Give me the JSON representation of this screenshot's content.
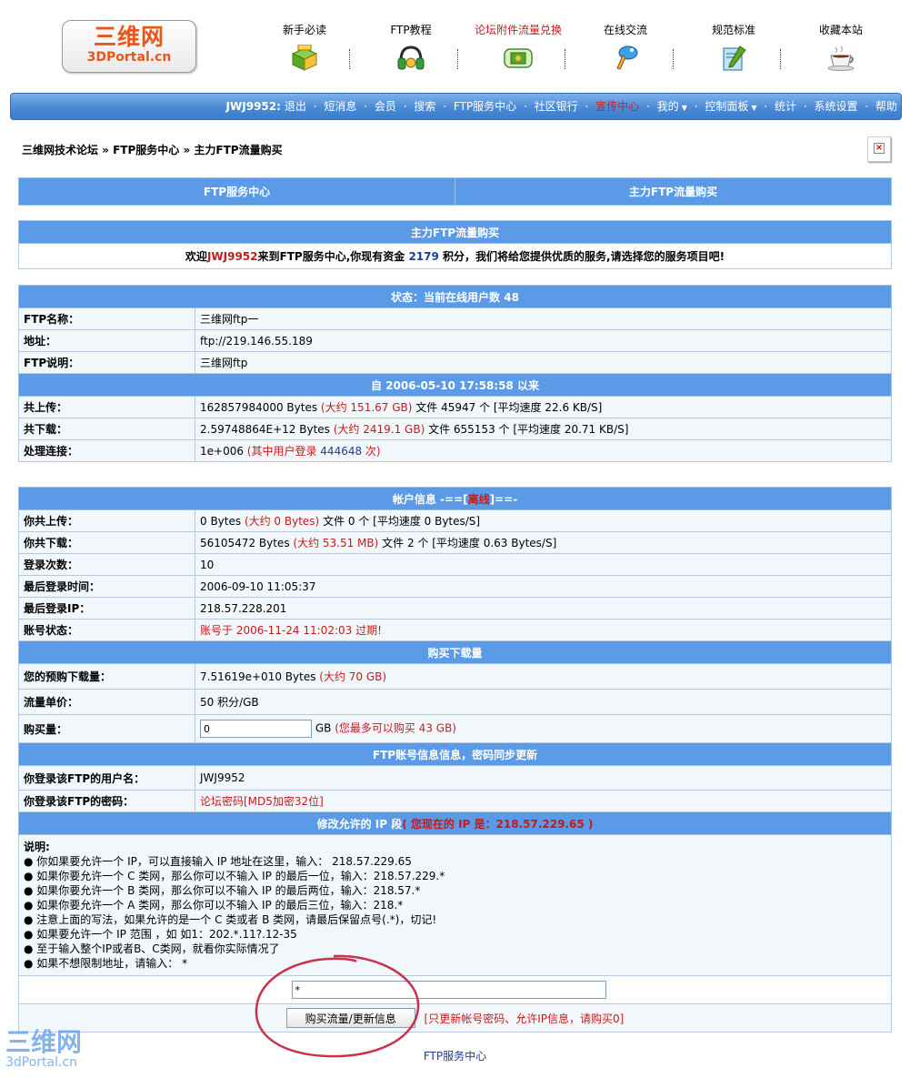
{
  "logo": {
    "cn": "三维网",
    "en": "3DPortal.cn"
  },
  "topnav": [
    {
      "label": "新手必读",
      "icon": "gift-box-icon",
      "color": "#000000"
    },
    {
      "label": "FTP教程",
      "icon": "headphones-icon",
      "color": "#000000"
    },
    {
      "label": "论坛附件流量兑换",
      "icon": "media-player-icon",
      "color": "#c41b1b"
    },
    {
      "label": "在线交流",
      "icon": "chat-pen-icon",
      "color": "#000000"
    },
    {
      "label": "规范标准",
      "icon": "document-edit-icon",
      "color": "#000000"
    },
    {
      "label": "收藏本站",
      "icon": "coffee-cup-icon",
      "color": "#000000"
    }
  ],
  "menubar": {
    "user": "JWJ9952:",
    "items": [
      "退出",
      "短消息",
      "会员",
      "搜索",
      "FTP服务中心",
      "社区银行",
      "宣传中心",
      "我的",
      "控制面板",
      "统计",
      "系统设置",
      "帮助"
    ]
  },
  "breadcrumb": "三维网技术论坛 » FTP服务中心 » 主力FTP流量购买",
  "tabs": [
    "FTP服务中心",
    "主力FTP流量购买"
  ],
  "welcome": {
    "title": "主力FTP流量购买",
    "pre": "欢迎",
    "user": "JWJ9952",
    "mid": "来到FTP服务中心,你现有资金 ",
    "points": "2179",
    "post": " 积分，我们将给您提供优质的服务,请选择您的服务项目吧!"
  },
  "status": {
    "title": "状态：当前在线用户数 48",
    "rows": [
      {
        "label": "FTP名称：",
        "value": "三维网ftp一"
      },
      {
        "label": "地址：",
        "value": "ftp://219.146.55.189"
      },
      {
        "label": "FTP说明：",
        "value": "三维网ftp"
      }
    ],
    "since": "自 2006-05-10 17:58:58 以来",
    "upload": {
      "label": "共上传：",
      "a": "162857984000 Bytes ",
      "b": "(大约 151.67 GB)",
      "c": " 文件 45947 个 [平均速度 22.6 KB/S]"
    },
    "download": {
      "label": "共下载：",
      "a": "2.59748864E+12 Bytes ",
      "b": "(大约 2419.1 GB)",
      "c": " 文件 655153 个 [平均速度 20.71 KB/S]"
    },
    "conn": {
      "label": "处理连接：",
      "a": "1e+006 ",
      "b": "(其中用户登录 ",
      "n": "444648",
      "c": " 次)"
    }
  },
  "account": {
    "title_pre": "帐户信息 -==[",
    "title_status": "离线",
    "title_post": "]==-",
    "upload": {
      "label": "你共上传：",
      "a": "0 Bytes ",
      "b": "(大约 0 Bytes)",
      "c": " 文件 0 个 [平均速度 0 Bytes/S]"
    },
    "download": {
      "label": "你共下载：",
      "a": "56105472 Bytes ",
      "b": "(大约 53.51 MB)",
      "c": " 文件 2 个 [平均速度 0.63 Bytes/S]"
    },
    "login_count": {
      "label": "登录次数：",
      "value": "10"
    },
    "last_login_time": {
      "label": "最后登录时间：",
      "value": "2006-09-10 11:05:37"
    },
    "last_login_ip": {
      "label": "最后登录IP：",
      "value": "218.57.228.201"
    },
    "acct_status": {
      "label": "账号状态：",
      "value": "账号于 2006-11-24 11:02:03 过期!"
    }
  },
  "buy": {
    "title": "购买下载量",
    "prebuy": {
      "label": "您的预购下载量：",
      "a": "7.51619e+010 Bytes ",
      "b": "(大约 70 GB)"
    },
    "unit": {
      "label": "流量单价：",
      "value": "50 积分/GB"
    },
    "amount": {
      "label": "购买量：",
      "input": "0",
      "unit": "GB ",
      "note": "(您最多可以购买 43 GB)"
    }
  },
  "ftpacct": {
    "title": "FTP账号信息信息，密码同步更新",
    "user": {
      "label": "你登录该FTP的用户名：",
      "value": "JWJ9952"
    },
    "pass": {
      "label": "你登录该FTP的密码：",
      "value": "论坛密码[MD5加密32位]"
    }
  },
  "ip": {
    "title_pre": "修改允许的 IP 段",
    "title_red": "( 您现在的 IP 是：218.57.229.65 )",
    "heading": "说明:",
    "lines": [
      "你如果要允许一个 IP，可以直接输入 IP 地址在这里，输入： 218.57.229.65",
      "如果你要允许一个 C 类网，那么你可以不输入 IP 的最后一位，输入：218.57.229.*",
      "如果你要允许一个 B 类网，那么你可以不输入 IP 的最后两位，输入：218.57.*",
      "如果你要允许一个 A 类网，那么你可以不输入 IP 的最后三位，输入：218.*",
      "注意上面的写法，如果允许的是一个 C 类或者 B 类网，请最后保留点号(.*)，切记!",
      "如果要允许一个 IP 范围 ，如 如1：202.*.11?.12-35",
      "至于输入整个IP或者B、C类网，就看你实际情况了",
      "如果不想限制地址，请输入： *"
    ],
    "input": "*",
    "button": "购买流量/更新信息",
    "note": "[只更新帐号密码、允许IP信息，请购买0]"
  },
  "footer": "FTP服务中心",
  "watermark": {
    "a": "三维网",
    "b": "3dPortal.cn"
  }
}
